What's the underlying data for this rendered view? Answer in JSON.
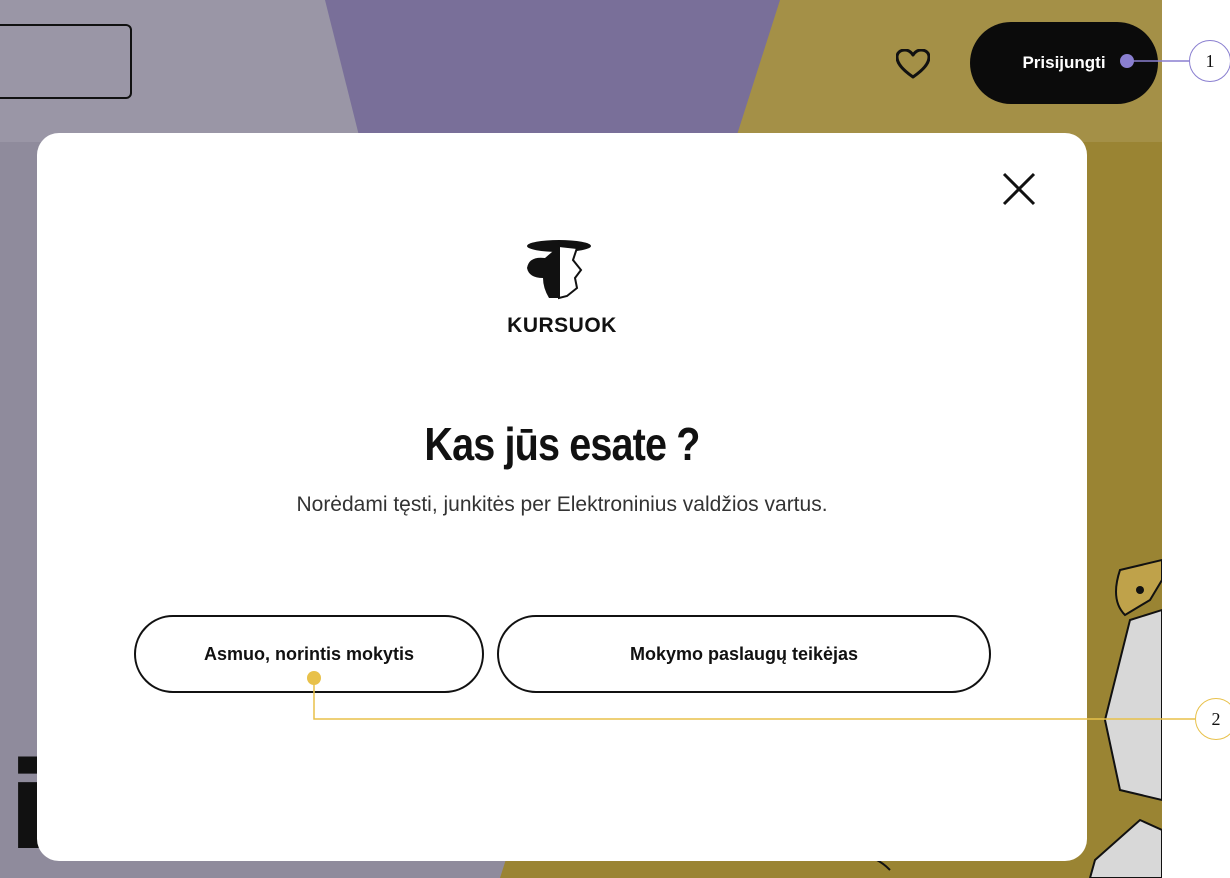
{
  "header": {
    "login_label": "Prisijungti"
  },
  "background": {
    "big_text": "i"
  },
  "modal": {
    "brand": "KURSUOK",
    "title": "Kas jūs esate ?",
    "subtitle": "Norėdami tęsti, junkitės per Elektroninius valdžios vartus.",
    "choices": [
      {
        "label": "Asmuo, norintis mokytis"
      },
      {
        "label": "Mokymo paslaugų teikėjas"
      }
    ]
  },
  "annotations": [
    {
      "number": "1",
      "color": "#8a7fd0"
    },
    {
      "number": "2",
      "color": "#e8c14a"
    }
  ],
  "colors": {
    "bg_gray": "#8f8b9c",
    "bg_purple": "#6a5f8e",
    "bg_gold": "#9a8433",
    "button_dark": "#0b0b0b"
  },
  "icons": [
    "heart-icon",
    "close-icon",
    "logo-mark"
  ]
}
